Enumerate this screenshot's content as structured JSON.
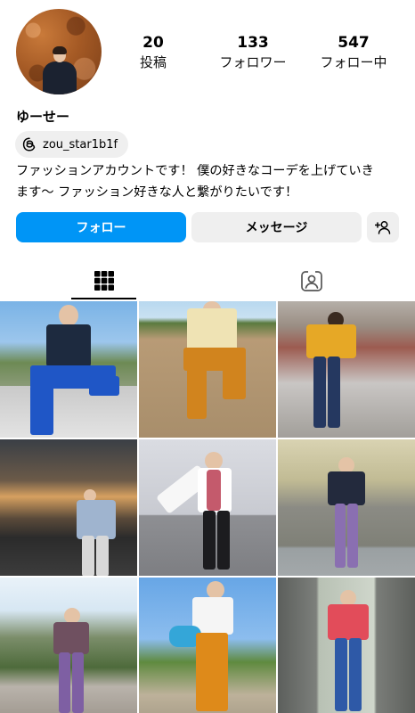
{
  "profile": {
    "posts_count": "20",
    "posts_label": "投稿",
    "followers_count": "133",
    "followers_label": "フォロワー",
    "following_count": "547",
    "following_label": "フォロー中",
    "username": "ゆーせー",
    "threads_handle": "zou_star1b1f",
    "bio_line1": "ファッションアカウントです！ 僕の好きなコーデを上げていき",
    "bio_line2": "ます〜 ファッション好きな人と繋がりたいです！"
  },
  "actions": {
    "follow_label": "フォロー",
    "message_label": "メッセージ"
  },
  "tabs": {
    "active": "posts-grid"
  },
  "icons": {
    "threads": "threads-icon",
    "add_person": "add-person-icon",
    "grid": "grid-icon",
    "tagged": "tagged-person-icon"
  },
  "colors": {
    "accent": "#0095f6",
    "button_bg": "#efefef",
    "text": "#000000"
  }
}
